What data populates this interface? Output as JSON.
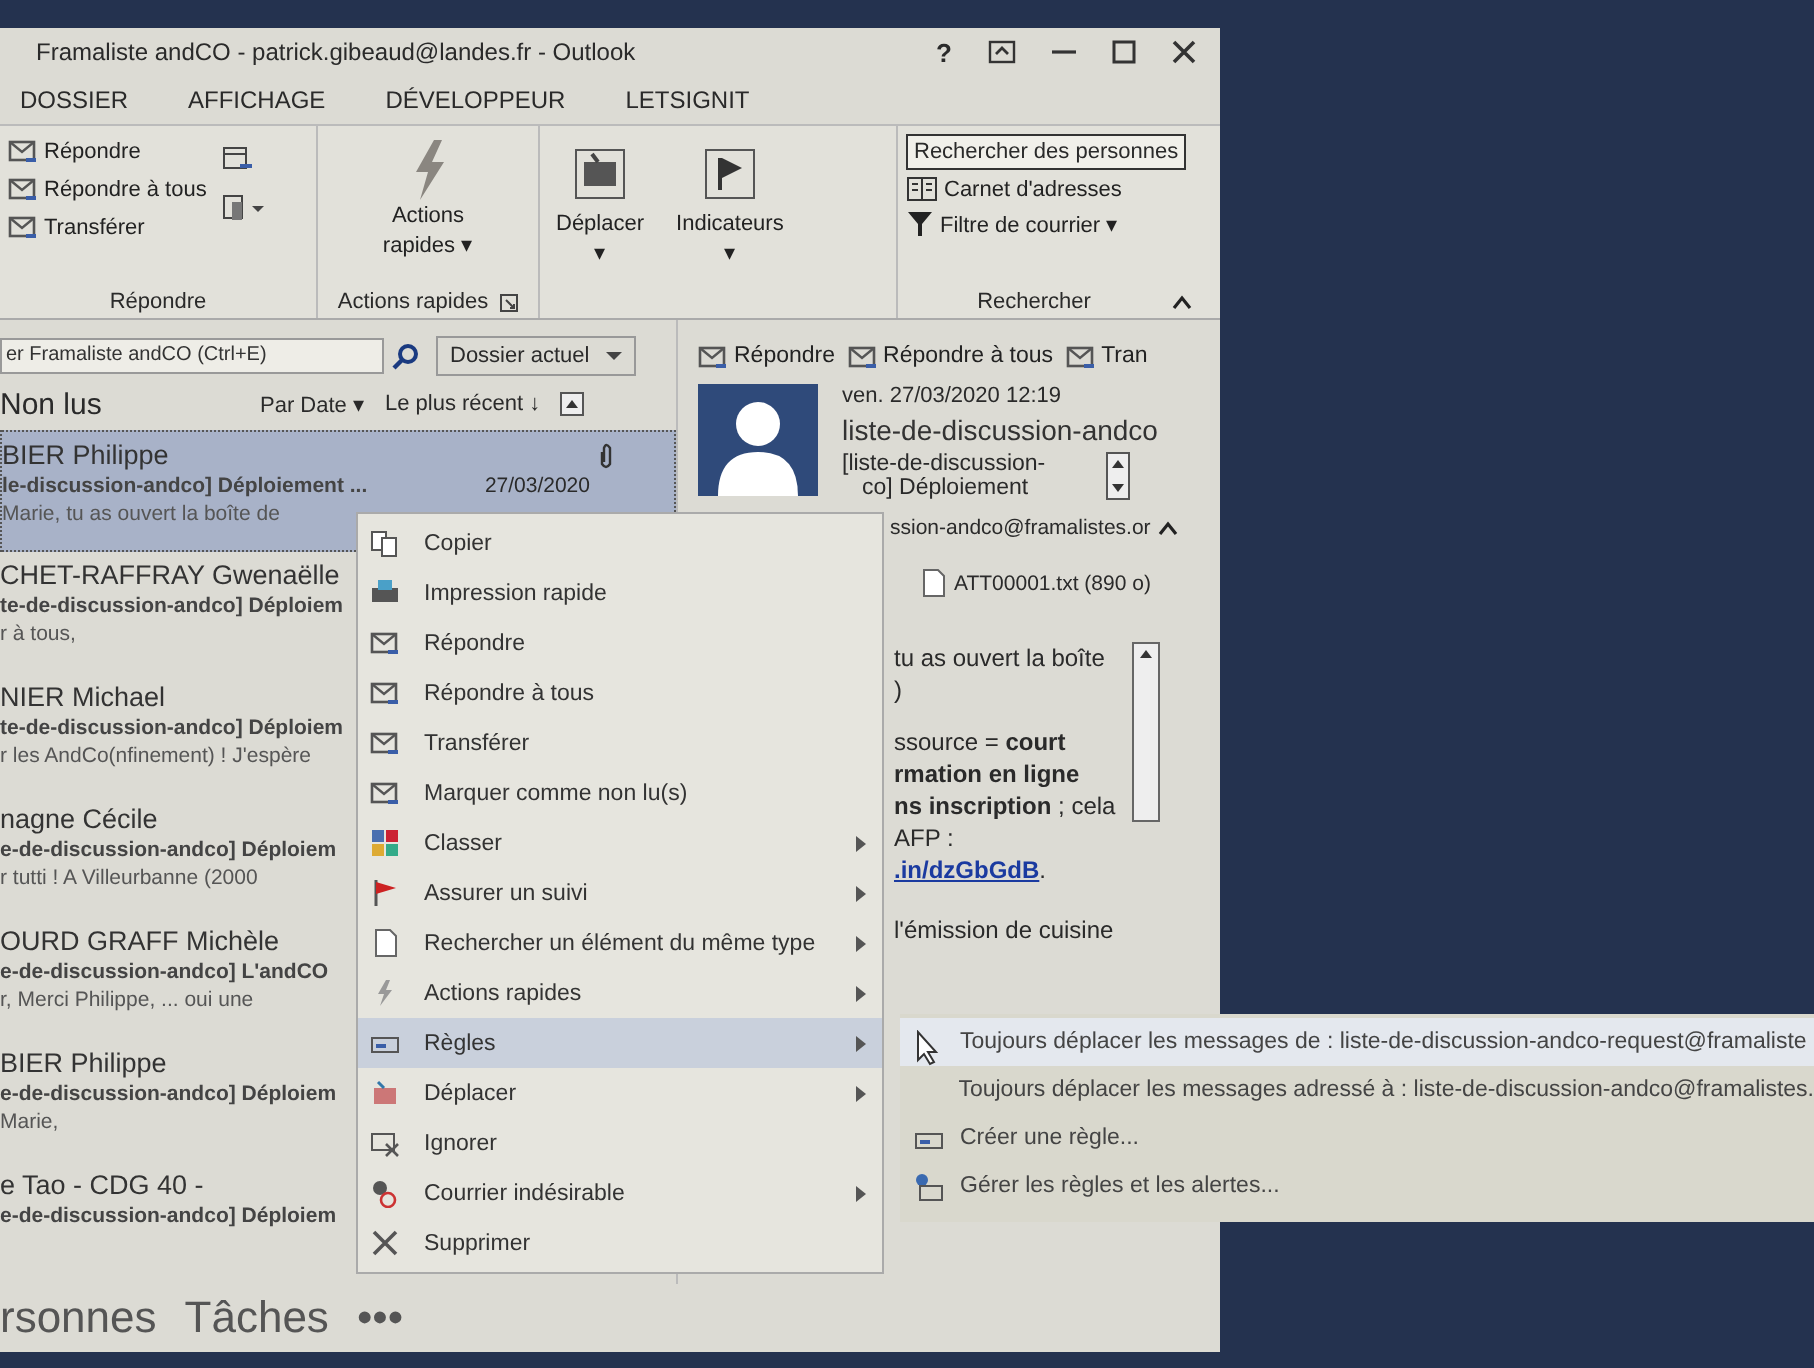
{
  "window": {
    "title": "Framaliste andCO - patrick.gibeaud@landes.fr - Outlook",
    "controls": [
      "?"
    ]
  },
  "tabs": [
    {
      "label": "DOSSIER",
      "selected": false
    },
    {
      "label": "AFFICHAGE",
      "selected": false
    },
    {
      "label": "DÉVELOPPEUR",
      "selected": false
    },
    {
      "label": "LETSIGNIT",
      "selected": false
    }
  ],
  "ribbon": {
    "respond": {
      "buttons": [
        "Répondre",
        "Répondre à tous",
        "Transférer"
      ],
      "label": "Répondre"
    },
    "quick": {
      "button": "Actions",
      "button_line2": "rapides ▾",
      "label": "Actions rapides"
    },
    "move": {
      "label": "Déplacer",
      "caret": "▾"
    },
    "flags": {
      "label": "Indicateurs",
      "caret": "▾"
    },
    "find": {
      "people": "Rechercher des personnes",
      "address_book": "Carnet d'adresses",
      "filter": "Filtre de courrier ▾",
      "label": "Rechercher"
    }
  },
  "search": {
    "placeholder": "er Framaliste andCO (Ctrl+E)",
    "scope": "Dossier actuel"
  },
  "list_header": {
    "title": "Non lus",
    "sort": "Par Date ▾",
    "order": "Le plus récent ↓"
  },
  "messages": [
    {
      "sender": "BIER Philippe",
      "subject": "le-discussion-andco] Déploiement ...",
      "date": "27/03/2020",
      "preview": "Marie, tu as ouvert la boîte de",
      "attachment": true,
      "selected": true
    },
    {
      "sender": "CHET-RAFFRAY Gwenaëlle",
      "subject": "te-de-discussion-andco] Déploiem",
      "preview": "r à tous,",
      "attachment": false,
      "selected": false
    },
    {
      "sender": "NIER Michael",
      "subject": "te-de-discussion-andco] Déploiem",
      "preview": "r les AndCo(nfinement) ! J'espère",
      "attachment": false,
      "selected": false
    },
    {
      "sender": "nagne Cécile",
      "subject": "e-de-discussion-andco] Déploiem",
      "preview": "r tutti ! A Villeurbanne (2000",
      "attachment": false,
      "selected": false
    },
    {
      "sender": "OURD GRAFF Michèle",
      "subject": "e-de-discussion-andco] L'andCO",
      "preview": "r, Merci Philippe, ... oui une",
      "attachment": false,
      "selected": false
    },
    {
      "sender": "BIER Philippe",
      "subject": "e-de-discussion-andco] Déploiem",
      "preview": "Marie,",
      "attachment": false,
      "selected": false
    },
    {
      "sender": "e Tao - CDG 40 -",
      "subject": "e-de-discussion-andco] Déploiem",
      "attachment": false,
      "selected": false
    }
  ],
  "nav": [
    "rsonnes",
    "Tâches",
    "•••"
  ],
  "reading": {
    "actions": [
      "Répondre",
      "Répondre à tous",
      "Tran"
    ],
    "date": "ven. 27/03/2020 12:19",
    "sender": "liste-de-discussion-andco",
    "subject_line1": "[liste-de-discussion-",
    "subject_line2": "co] Déploiement",
    "to": "ssion-andco@framalistes.or",
    "attachment": "ATT00001.txt (890 o)",
    "body": [
      "tu as ouvert la boîte",
      ")",
      "ssource = **court**",
      "**rmation en ligne**",
      "**ns inscription** ; cela",
      "AFP :"
    ],
    "link": ".in/dzGbGdB",
    "link_tail": ".",
    "body_tail": "l'émission de cuisine"
  },
  "context_menu": [
    {
      "label": "Copier",
      "submenu": false,
      "selected": false
    },
    {
      "label": "Impression rapide",
      "submenu": false,
      "selected": false
    },
    {
      "label": "Répondre",
      "submenu": false,
      "selected": false
    },
    {
      "label": "Répondre à tous",
      "submenu": false,
      "selected": false
    },
    {
      "label": "Transférer",
      "submenu": false,
      "selected": false
    },
    {
      "label": "Marquer comme non lu(s)",
      "submenu": false,
      "selected": false
    },
    {
      "label": "Classer",
      "submenu": true,
      "selected": false
    },
    {
      "label": "Assurer un suivi",
      "submenu": true,
      "selected": false
    },
    {
      "label": "Rechercher un élément du même type",
      "submenu": true,
      "selected": false
    },
    {
      "label": "Actions rapides",
      "submenu": true,
      "selected": false
    },
    {
      "label": "Règles",
      "submenu": true,
      "selected": true
    },
    {
      "label": "Déplacer",
      "submenu": true,
      "selected": false
    },
    {
      "label": "Ignorer",
      "submenu": false,
      "selected": false
    },
    {
      "label": "Courrier indésirable",
      "submenu": true,
      "selected": false
    },
    {
      "label": "Supprimer",
      "submenu": false,
      "selected": false
    }
  ],
  "rules_submenu": [
    {
      "label": "Toujours déplacer les messages de : liste-de-discussion-andco-request@framaliste",
      "selected": true
    },
    {
      "label": "Toujours déplacer les messages adressé à : liste-de-discussion-andco@framalistes.",
      "selected": false
    },
    {
      "label": "Créer une règle...",
      "selected": false
    },
    {
      "label": "Gérer les règles et les alertes...",
      "selected": false
    }
  ]
}
